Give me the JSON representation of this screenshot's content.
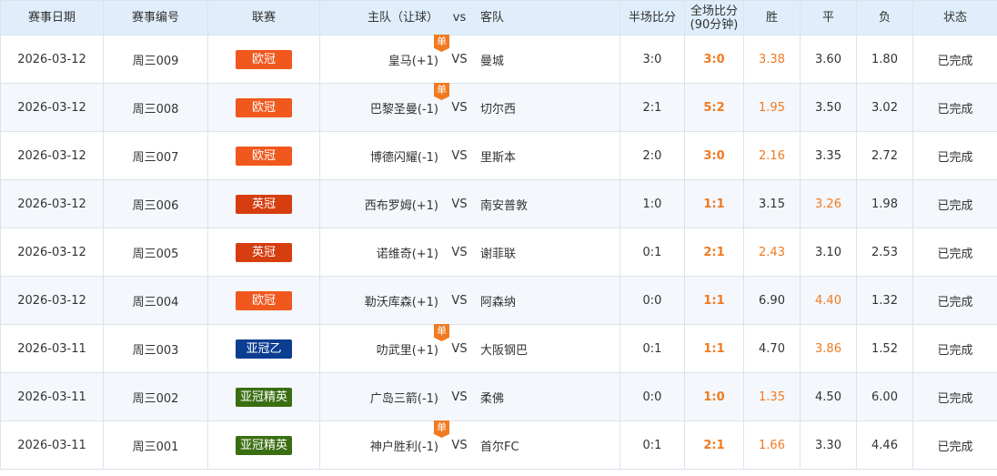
{
  "colors": {
    "header_bg": "#dfeefa",
    "accent_orange": "#f07a22",
    "row_alt": "#f4f7fb",
    "border": "#dbe3ec"
  },
  "headers": {
    "date": "赛事日期",
    "code": "赛事编号",
    "league": "联赛",
    "home": "主队（让球）",
    "vs": "vs",
    "away": "客队",
    "half": "半场比分",
    "full_line1": "全场比分",
    "full_line2": "(90分钟)",
    "win": "胜",
    "draw": "平",
    "lose": "负",
    "status": "状态"
  },
  "leagues": {
    "ucl": {
      "name": "欧冠",
      "color": "#f0581e"
    },
    "efl": {
      "name": "英冠",
      "color": "#d63d0f"
    },
    "acl2": {
      "name": "亚冠乙",
      "color": "#0b3d91"
    },
    "acle": {
      "name": "亚冠精英",
      "color": "#3a6e12"
    }
  },
  "dan_label": "单",
  "rows": [
    {
      "date": "2026-03-12",
      "code": "周三009",
      "league": "欧冠",
      "league_color": "#f0581e",
      "dan": true,
      "home": "皇马(+1)",
      "vs": "VS",
      "away": "曼城",
      "half": "3:0",
      "full": "3:0",
      "win": "3.38",
      "draw": "3.60",
      "lose": "1.80",
      "result": "win",
      "status": "已完成"
    },
    {
      "date": "2026-03-12",
      "code": "周三008",
      "league": "欧冠",
      "league_color": "#f0581e",
      "dan": true,
      "home": "巴黎圣曼(-1)",
      "vs": "VS",
      "away": "切尔西",
      "half": "2:1",
      "full": "5:2",
      "win": "1.95",
      "draw": "3.50",
      "lose": "3.02",
      "result": "win",
      "status": "已完成"
    },
    {
      "date": "2026-03-12",
      "code": "周三007",
      "league": "欧冠",
      "league_color": "#f0581e",
      "dan": false,
      "home": "博德闪耀(-1)",
      "vs": "VS",
      "away": "里斯本",
      "half": "2:0",
      "full": "3:0",
      "win": "2.16",
      "draw": "3.35",
      "lose": "2.72",
      "result": "win",
      "status": "已完成"
    },
    {
      "date": "2026-03-12",
      "code": "周三006",
      "league": "英冠",
      "league_color": "#d63d0f",
      "dan": false,
      "home": "西布罗姆(+1)",
      "vs": "VS",
      "away": "南安普敦",
      "half": "1:0",
      "full": "1:1",
      "win": "3.15",
      "draw": "3.26",
      "lose": "1.98",
      "result": "draw",
      "status": "已完成"
    },
    {
      "date": "2026-03-12",
      "code": "周三005",
      "league": "英冠",
      "league_color": "#d63d0f",
      "dan": false,
      "home": "诺维奇(+1)",
      "vs": "VS",
      "away": "谢菲联",
      "half": "0:1",
      "full": "2:1",
      "win": "2.43",
      "draw": "3.10",
      "lose": "2.53",
      "result": "win",
      "status": "已完成"
    },
    {
      "date": "2026-03-12",
      "code": "周三004",
      "league": "欧冠",
      "league_color": "#f0581e",
      "dan": false,
      "home": "勒沃库森(+1)",
      "vs": "VS",
      "away": "阿森纳",
      "half": "0:0",
      "full": "1:1",
      "win": "6.90",
      "draw": "4.40",
      "lose": "1.32",
      "result": "draw",
      "status": "已完成"
    },
    {
      "date": "2026-03-11",
      "code": "周三003",
      "league": "亚冠乙",
      "league_color": "#0b3d91",
      "dan": true,
      "home": "叻武里(+1)",
      "vs": "VS",
      "away": "大阪钢巴",
      "half": "0:1",
      "full": "1:1",
      "win": "4.70",
      "draw": "3.86",
      "lose": "1.52",
      "result": "draw",
      "status": "已完成"
    },
    {
      "date": "2026-03-11",
      "code": "周三002",
      "league": "亚冠精英",
      "league_color": "#3a6e12",
      "dan": false,
      "home": "广岛三箭(-1)",
      "vs": "VS",
      "away": "柔佛",
      "half": "0:0",
      "full": "1:0",
      "win": "1.35",
      "draw": "4.50",
      "lose": "6.00",
      "result": "win",
      "status": "已完成"
    },
    {
      "date": "2026-03-11",
      "code": "周三001",
      "league": "亚冠精英",
      "league_color": "#3a6e12",
      "dan": true,
      "home": "神户胜利(-1)",
      "vs": "VS",
      "away": "首尔FC",
      "half": "0:1",
      "full": "2:1",
      "win": "1.66",
      "draw": "3.30",
      "lose": "4.46",
      "result": "win",
      "status": "已完成"
    }
  ]
}
